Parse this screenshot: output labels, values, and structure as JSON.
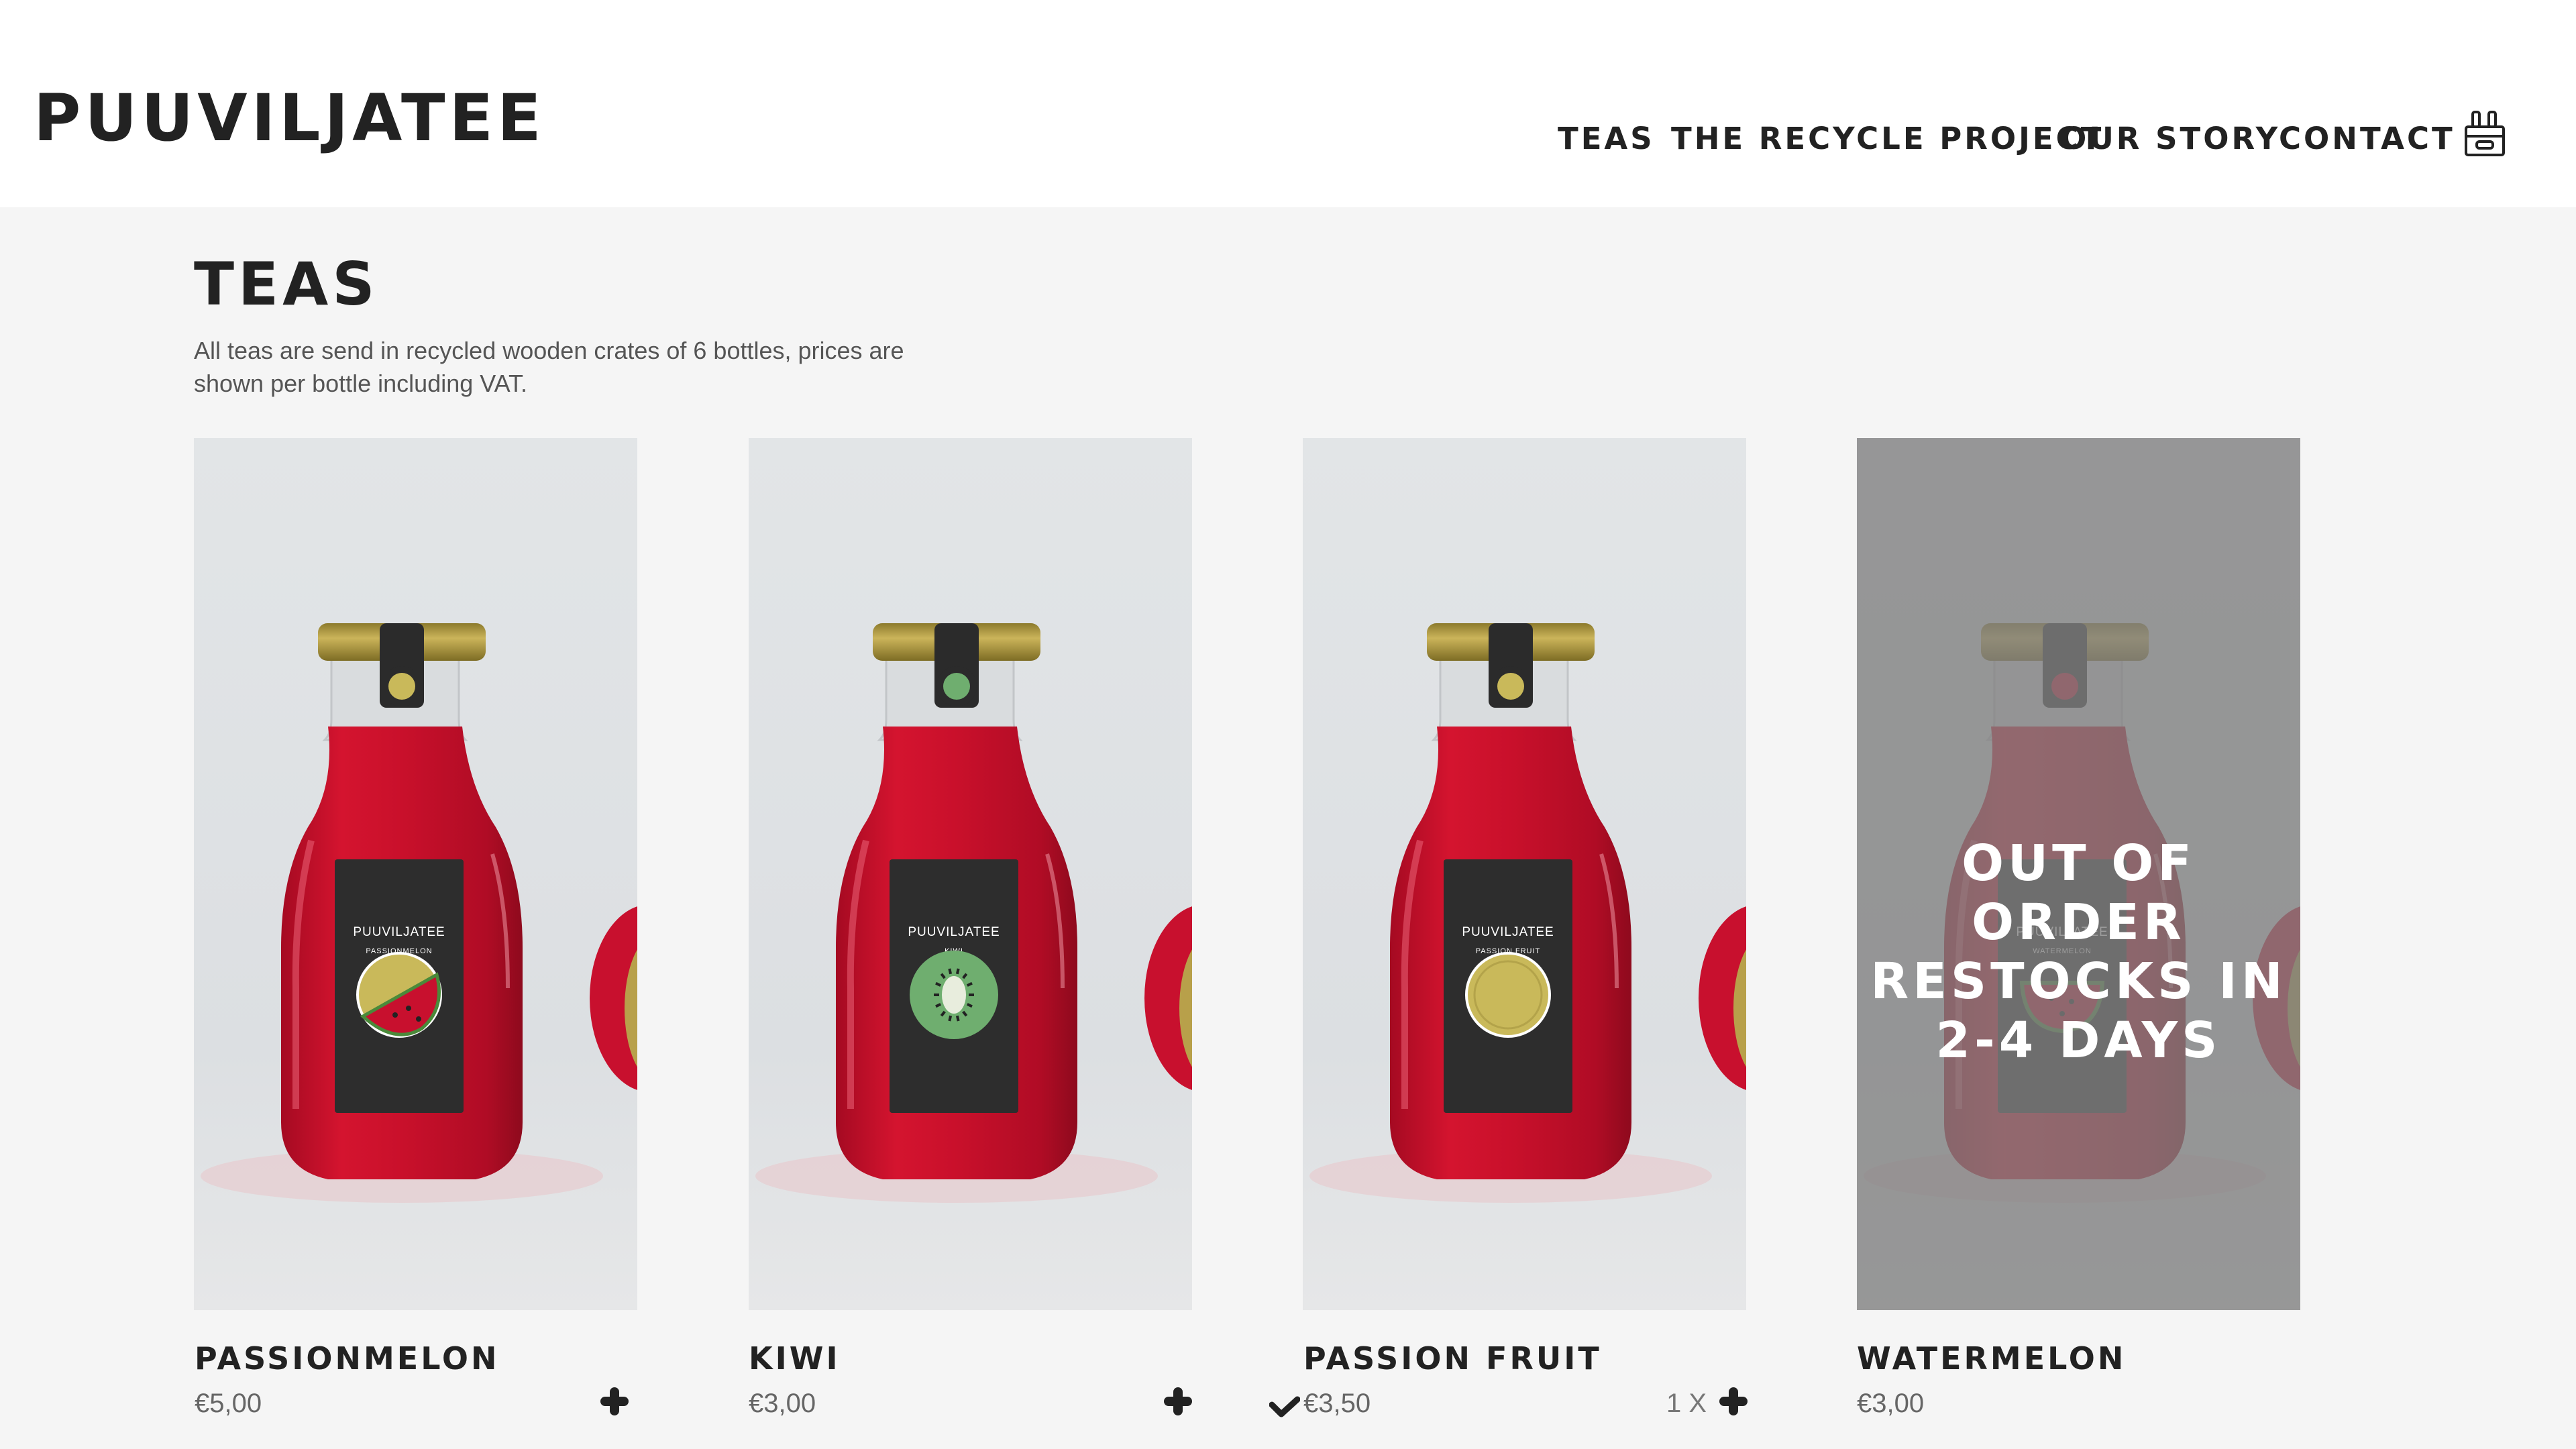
{
  "header": {
    "logo": "PUUVILJATEE",
    "nav": {
      "teas": "TEAS",
      "recycle": "THE RECYCLE PROJECT",
      "story": "OUR STORY",
      "contact": "CONTACT"
    },
    "cart_icon": "bottle-crate-icon"
  },
  "page": {
    "title": "TEAS",
    "description": "All teas are send in recycled wooden crates of 6 bottles, prices are shown per bottle including VAT."
  },
  "products": [
    {
      "name": "PASSIONMELON",
      "price": "€5,00",
      "label_brand": "PUUVILJATEE",
      "label_flavor": "PASSIONMELON",
      "fruit_icon": "passionmelon-icon",
      "in_stock": true
    },
    {
      "name": "KIWI",
      "price": "€3,00",
      "label_brand": "PUUVILJATEE",
      "label_flavor": "KIWI",
      "fruit_icon": "kiwi-icon",
      "in_stock": true
    },
    {
      "name": "PASSION FRUIT",
      "price": "€3,50",
      "label_brand": "PUUVILJATEE",
      "label_flavor": "PASSION FRUIT",
      "fruit_icon": "passion-fruit-icon",
      "in_stock": true,
      "in_cart": true,
      "quantity": "1 X"
    },
    {
      "name": "WATERMELON",
      "price": "€3,00",
      "label_brand": "PUUVILJATEE",
      "label_flavor": "WATERMELON",
      "fruit_icon": "watermelon-icon",
      "in_stock": false,
      "overlay_text": "OUT OF ORDER\nRESTOCKS IN\n2-4 DAYS"
    }
  ],
  "colors": {
    "text": "#222222",
    "page_bg": "#f5f5f5",
    "header_bg": "#ffffff",
    "tea_red": "#c8102e",
    "bottle_cap": "#b8a04a",
    "label_dark": "#2d2d2d",
    "kiwi_green": "#6fae6f",
    "melon_yellow": "#c9b95a"
  }
}
